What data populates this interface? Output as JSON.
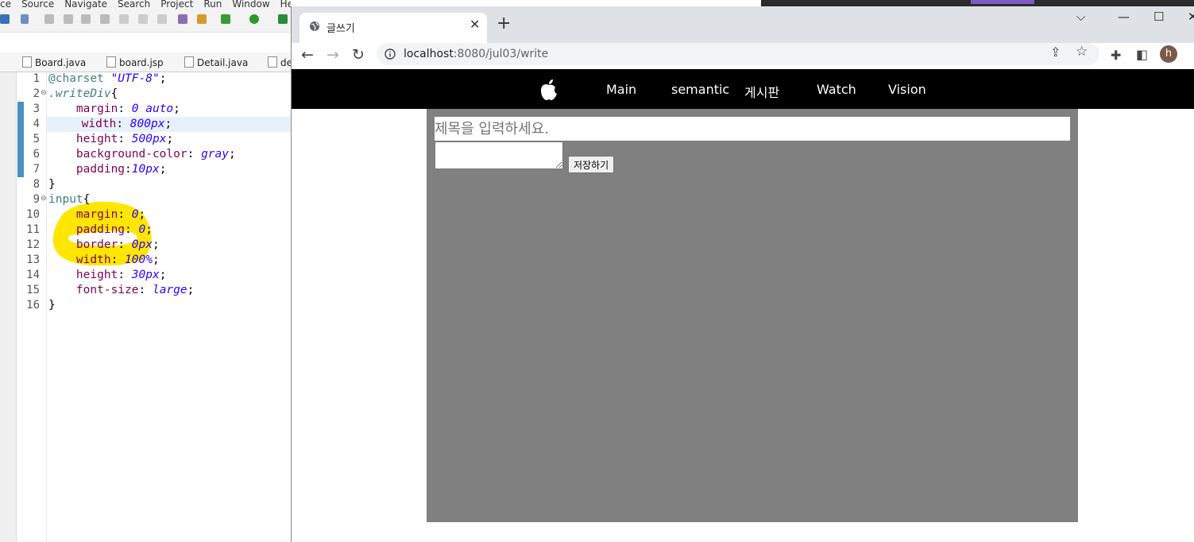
{
  "ide": {
    "menu": [
      "ce",
      "Source",
      "Navigate",
      "Search",
      "Project",
      "Run",
      "Window",
      "Help"
    ],
    "tabs": [
      "Board.java",
      "board.jsp",
      "Detail.java",
      "de"
    ],
    "line_numbers": [
      "1",
      "2",
      "3",
      "4",
      "5",
      "6",
      "7",
      "8",
      "9",
      "10",
      "11",
      "12",
      "13",
      "14",
      "15",
      "16"
    ],
    "code": {
      "l1_kw": "@charset ",
      "l1_val": "\"UTF-8\"",
      "l1_end": ";",
      "l2_sel": ".writeDiv",
      "l2_brace": "{",
      "l3_prop": "margin",
      "l3_val": "0 auto",
      "l4_prop": "width",
      "l4_val": "800px",
      "l5_prop": "height",
      "l5_val": "500px",
      "l6_prop": "background-color",
      "l6_val": "gray",
      "l7_prop": "padding",
      "l7_val": "10px",
      "l8": "}",
      "l9_sel": "input",
      "l9_brace": "{",
      "l10_prop": "margin",
      "l10_val": "0",
      "l11_prop": "padding",
      "l11_val": "0",
      "l12_prop": "border",
      "l12_val": "0px",
      "l13_prop": "width",
      "l13_val": "100%",
      "l14_prop": "height",
      "l14_val": "30px",
      "l15_prop": "font-size",
      "l15_val": "large",
      "l16": "}"
    },
    "colors": {
      "highlight": "#ffe600",
      "property": "#7f0055",
      "value": "#2a00ff"
    }
  },
  "browser": {
    "tab_title": "글쓰기",
    "url_host": "localhost",
    "url_rest": ":8080/jul03/write",
    "profile_initial": "h",
    "nav": {
      "main": "Main",
      "semantic": "semantic",
      "board": "게시판",
      "watch": "Watch",
      "vision": "Vision"
    },
    "form": {
      "title_placeholder": "제목을 입력하세요.",
      "save_label": "저장하기"
    }
  }
}
